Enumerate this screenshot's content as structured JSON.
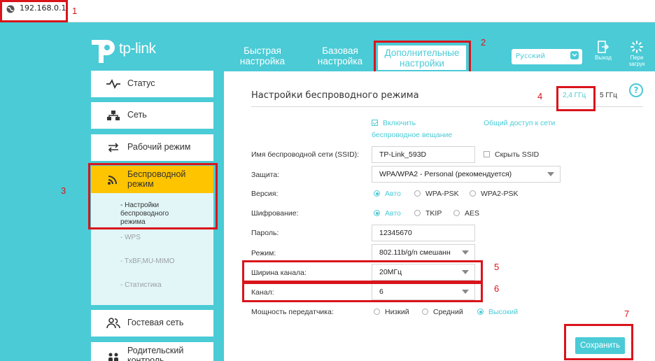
{
  "browser": {
    "url": "192.168.0.1"
  },
  "annotations": [
    "1",
    "2",
    "3",
    "4",
    "5",
    "6",
    "7"
  ],
  "header": {
    "brand": "tp-link",
    "tabs": [
      {
        "label": "Быстрая настройка"
      },
      {
        "label": "Базовая настройка"
      },
      {
        "label": "Дополнительные настройки"
      }
    ],
    "language": "Русский",
    "logout": "Выход",
    "reboot": "Пере загрук"
  },
  "sidebar": {
    "items": [
      {
        "label": "Статус"
      },
      {
        "label": "Сеть"
      },
      {
        "label": "Рабочий режим"
      },
      {
        "label": "Беспроводной режим"
      },
      {
        "label": "Гостевая сеть"
      },
      {
        "label": "Родительский контроль"
      }
    ],
    "subitems": [
      {
        "label": "- Настройки беспроводного режима"
      },
      {
        "label": "- WPS"
      },
      {
        "label": "- TxBF,MU-MIMO"
      },
      {
        "label": "- Статистика"
      }
    ]
  },
  "main": {
    "title": "Настройки беспроводного режима",
    "band_24": "2,4 ГГц",
    "band_5": "5 ГГц",
    "enable_label": "Включить",
    "broadcast_label": "беспроводное вещание",
    "share_link": "Общий доступ к сети",
    "fields": {
      "ssid": {
        "label": "Имя беспроводной сети (SSID):",
        "value": "TP-Link_593D",
        "hide_label": "Скрыть SSID"
      },
      "security": {
        "label": "Защита:",
        "value": "WPA/WPA2 - Personal (рекомендуется)"
      },
      "version": {
        "label": "Версия:",
        "options": [
          "Авто",
          "WPA-PSK",
          "WPA2-PSK"
        ]
      },
      "encryption": {
        "label": "Шифрование:",
        "options": [
          "Авто",
          "TKIP",
          "AES"
        ]
      },
      "password": {
        "label": "Пароль:",
        "value": "12345670"
      },
      "mode": {
        "label": "Режим:",
        "value": "802.11b/g/n смешанн"
      },
      "width": {
        "label": "Ширина канала:",
        "value": "20МГц"
      },
      "channel": {
        "label": "Канал:",
        "value": "6"
      },
      "power": {
        "label": "Мощность передатчика:",
        "options": [
          "Низкий",
          "Средний",
          "Высокий"
        ]
      }
    },
    "save_label": "Сохранить"
  },
  "colors": {
    "accent": "#4acbd6",
    "active_nav": "#ffc400",
    "highlight": "#d9141b"
  }
}
